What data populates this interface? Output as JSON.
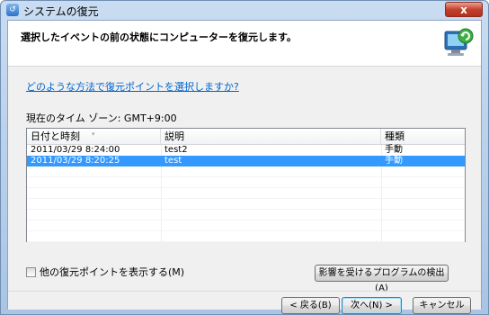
{
  "window": {
    "title": "システムの復元",
    "close_label": "x"
  },
  "header": {
    "instruction": "選択したイベントの前の状態にコンピューターを復元します。"
  },
  "help_link": "どのような方法で復元ポイントを選択しますか?",
  "timezone_label": "現在のタイム ゾーン: GMT+9:00",
  "list": {
    "columns": [
      "日付と時刻",
      "説明",
      "種類"
    ],
    "rows": [
      {
        "datetime": "2011/03/29 8:24:00",
        "description": "test2",
        "type": "手動",
        "selected": false
      },
      {
        "datetime": "2011/03/29 8:20:25",
        "description": "test",
        "type": "手動",
        "selected": true
      }
    ]
  },
  "show_more_checkbox": {
    "label": "他の復元ポイントを表示する(M)",
    "checked": false
  },
  "buttons": {
    "scan": "影響を受けるプログラムの検出(A)",
    "back": "< 戻る(B)",
    "next": "次へ(N) >",
    "cancel": "キャンセル"
  }
}
